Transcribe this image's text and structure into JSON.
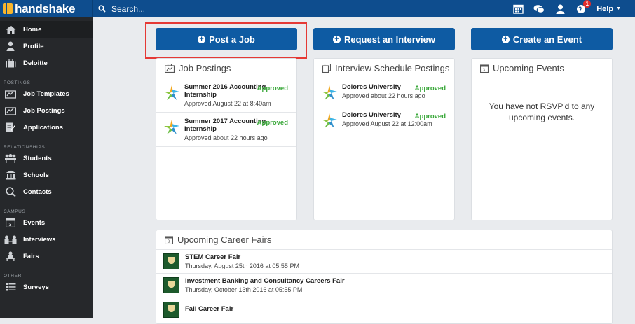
{
  "topbar": {
    "brand": "handshake",
    "search_label": "Search...",
    "notification_count": "1",
    "help_label": "Help"
  },
  "sidebar": {
    "items_top": [
      {
        "label": "Home",
        "icon": "home-icon",
        "active": true
      },
      {
        "label": "Profile",
        "icon": "user-icon"
      },
      {
        "label": "Deloitte",
        "icon": "building-icon"
      }
    ],
    "sections": [
      {
        "title": "POSTINGS",
        "items": [
          {
            "label": "Job Templates",
            "icon": "briefcase-icon"
          },
          {
            "label": "Job Postings",
            "icon": "briefcase-icon"
          },
          {
            "label": "Applications",
            "icon": "application-icon"
          }
        ]
      },
      {
        "title": "RELATIONSHIPS",
        "items": [
          {
            "label": "Students",
            "icon": "students-icon"
          },
          {
            "label": "Schools",
            "icon": "school-icon"
          },
          {
            "label": "Contacts",
            "icon": "contacts-icon"
          }
        ]
      },
      {
        "title": "CAMPUS",
        "items": [
          {
            "label": "Events",
            "icon": "calendar-icon"
          },
          {
            "label": "Interviews",
            "icon": "interviews-icon"
          },
          {
            "label": "Fairs",
            "icon": "fairs-icon"
          }
        ]
      },
      {
        "title": "OTHER",
        "items": [
          {
            "label": "Surveys",
            "icon": "surveys-icon"
          }
        ]
      }
    ]
  },
  "actions": {
    "post_job": "Post a Job",
    "request_interview": "Request an Interview",
    "create_event": "Create an Event"
  },
  "job_postings": {
    "title": "Job Postings",
    "items": [
      {
        "name": "Summer 2016 Accounting Internship",
        "sub": "Approved August 22 at 8:40am",
        "status": "Approved"
      },
      {
        "name": "Summer 2017 Accounting Internship",
        "sub": "Approved about 22 hours ago",
        "status": "Approved"
      }
    ]
  },
  "interview_postings": {
    "title": "Interview Schedule Postings",
    "items": [
      {
        "name": "Dolores University",
        "sub": "Approved about 22 hours ago",
        "status": "Approved"
      },
      {
        "name": "Dolores University",
        "sub": "Approved August 22 at 12:00am",
        "status": "Approved"
      }
    ]
  },
  "upcoming_events": {
    "title": "Upcoming Events",
    "empty_text": "You have not RSVP'd to any upcoming events."
  },
  "career_fairs": {
    "title": "Upcoming Career Fairs",
    "items": [
      {
        "name": "STEM Career Fair",
        "date": "Thursday, August 25th 2016 at 05:55 PM"
      },
      {
        "name": "Investment Banking and Consultancy Careers Fair",
        "date": "Thursday, October 13th 2016 at 05:55 PM"
      },
      {
        "name": "Fall Career Fair",
        "date": ""
      }
    ]
  },
  "colors": {
    "topbar": "#0e4d8e",
    "sidebar": "#26282b",
    "button": "#0e5ba3",
    "approved": "#3aa83a",
    "highlight": "#e53935"
  }
}
